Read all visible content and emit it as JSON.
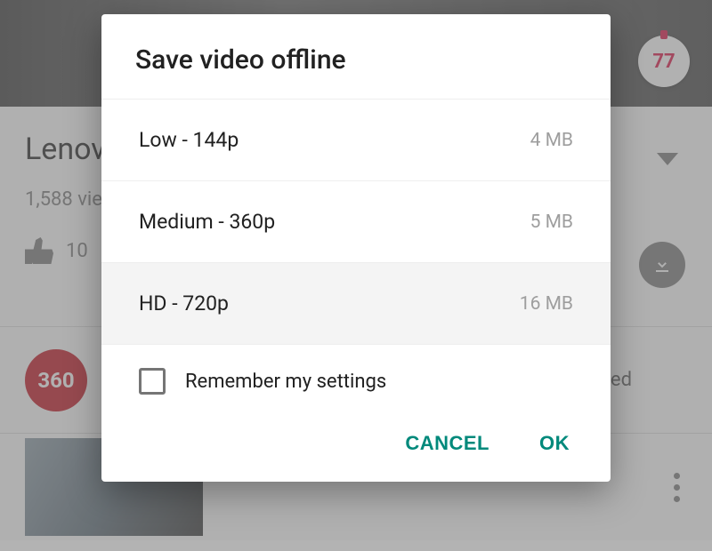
{
  "background": {
    "timer_value": "77",
    "video_title_truncated": "Lenov",
    "views_text": "1,588 vie",
    "like_count": "10",
    "subscribed_text_truncated": "bscribed",
    "channel_badge_text": "360"
  },
  "dialog": {
    "title": "Save video offline",
    "options": [
      {
        "label": "Low - 144p",
        "size": "4 MB",
        "selected": false
      },
      {
        "label": "Medium - 360p",
        "size": "5 MB",
        "selected": false
      },
      {
        "label": "HD - 720p",
        "size": "16 MB",
        "selected": true
      }
    ],
    "remember_checked": false,
    "remember_label": "Remember my settings",
    "cancel_label": "CANCEL",
    "ok_label": "OK"
  }
}
